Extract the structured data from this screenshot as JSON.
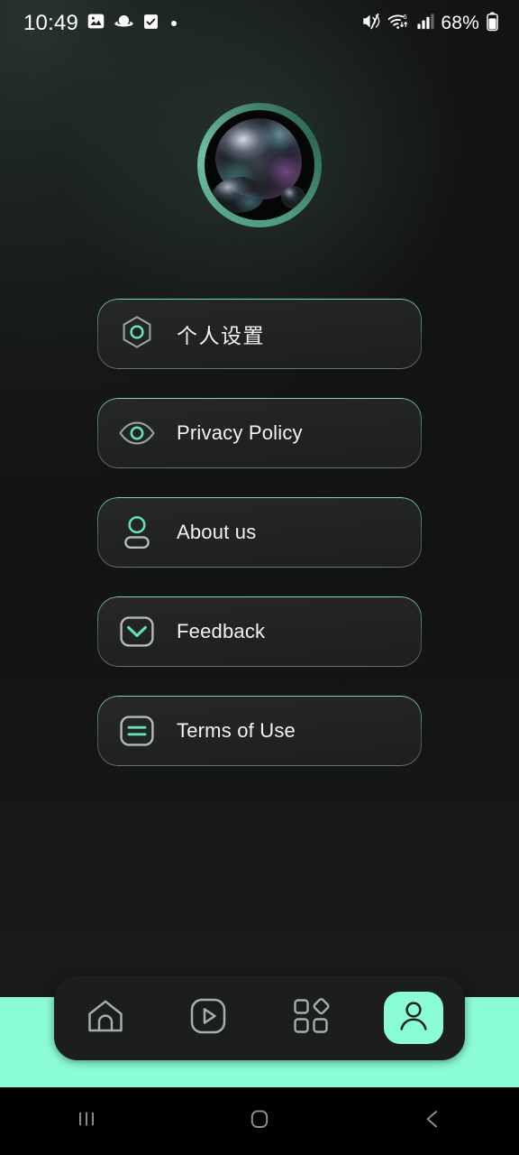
{
  "status_bar": {
    "time": "10:49",
    "battery_percent": "68%",
    "left_icons": [
      "photo-icon",
      "saturn-icon",
      "checkbox-icon",
      "dot-indicator"
    ],
    "right_icons": [
      "mute-icon",
      "wifi-6-icon",
      "cellular-signal-icon",
      "battery-icon"
    ]
  },
  "profile": {
    "avatar_alt": "bubble-avatar",
    "ring_color": "#57a286"
  },
  "menu": {
    "items": [
      {
        "label": "个人设置",
        "icon": "hexagon-settings-icon",
        "lang": "cjk"
      },
      {
        "label": "Privacy Policy",
        "icon": "eye-icon",
        "lang": "latin"
      },
      {
        "label": "About us",
        "icon": "person-icon",
        "lang": "latin"
      },
      {
        "label": "Feedback",
        "icon": "mail-icon",
        "lang": "latin"
      },
      {
        "label": "Terms of Use",
        "icon": "document-lines-icon",
        "lang": "latin"
      }
    ]
  },
  "bottom_nav": {
    "items": [
      {
        "name": "home",
        "icon": "home-icon",
        "active": false
      },
      {
        "name": "video",
        "icon": "play-square-icon",
        "active": false
      },
      {
        "name": "apps",
        "icon": "grid-apps-icon",
        "active": false
      },
      {
        "name": "profile",
        "icon": "person-icon",
        "active": true
      }
    ],
    "active_color": "#8afcd6"
  },
  "system_nav": {
    "items": [
      "recents-icon",
      "home-icon",
      "back-icon"
    ]
  },
  "theme": {
    "accent": "#8afcd6",
    "accent_muted": "#57a286",
    "background": "#111212",
    "card_background": "#222424",
    "text_primary": "#f2f3f3"
  }
}
